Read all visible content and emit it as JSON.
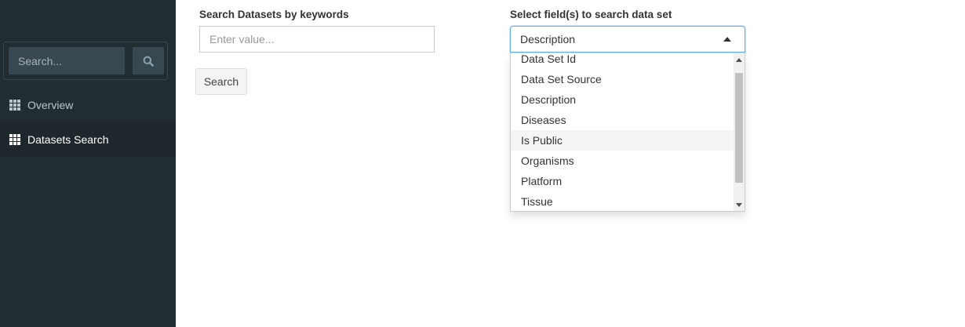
{
  "sidebar": {
    "search": {
      "placeholder": "Search...",
      "icon": "search-icon"
    },
    "menu": [
      {
        "label": "Overview",
        "icon": "th-icon",
        "active": false
      },
      {
        "label": "Datasets Search",
        "icon": "th-icon",
        "active": true
      }
    ]
  },
  "main": {
    "keywords": {
      "label": "Search Datasets by keywords",
      "placeholder": "Enter value...",
      "value": ""
    },
    "search_button": "Search",
    "fields": {
      "label": "Select field(s) to search data set",
      "selected": "Description",
      "options": [
        "Data Set Id",
        "Data Set Source",
        "Description",
        "Diseases",
        "Is Public",
        "Organisms",
        "Platform",
        "Tissue"
      ],
      "highlighted": "Is Public"
    }
  },
  "colors": {
    "sidebar_bg": "#222d32",
    "sidebar_active_bg": "#1e282c",
    "focus_border": "#66afe9"
  }
}
